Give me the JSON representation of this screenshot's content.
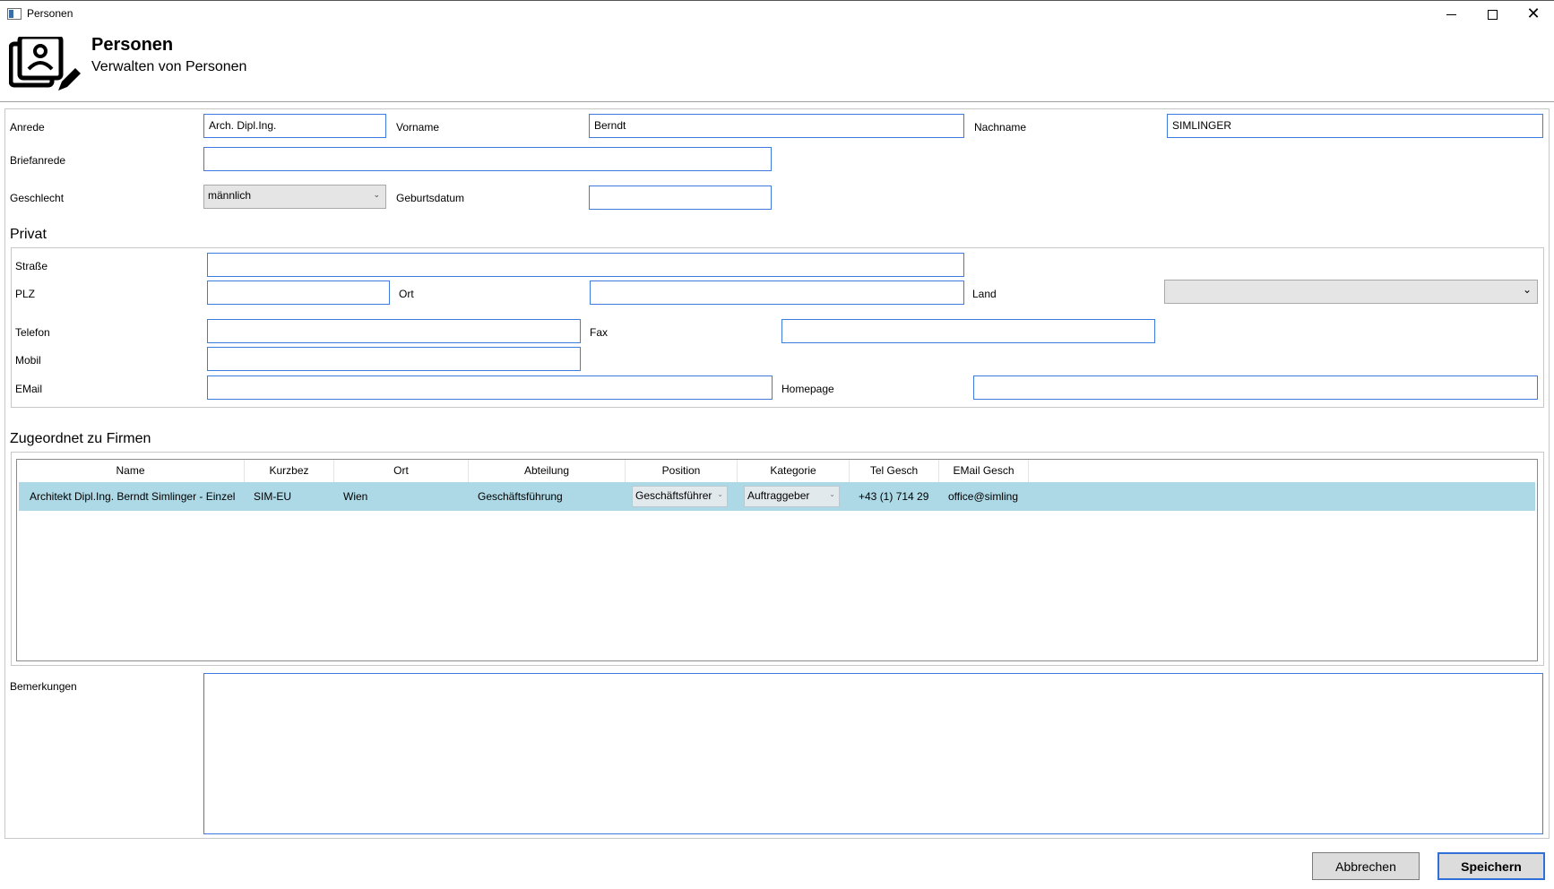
{
  "window": {
    "title": "Personen"
  },
  "header": {
    "title": "Personen",
    "subtitle": "Verwalten von Personen",
    "icon": "contacts-edit-icon"
  },
  "person": {
    "anrede_label": "Anrede",
    "anrede_value": "Arch. Dipl.Ing.",
    "vorname_label": "Vorname",
    "vorname_value": "Berndt",
    "nachname_label": "Nachname",
    "nachname_value": "SIMLINGER",
    "briefanrede_label": "Briefanrede",
    "briefanrede_value": "",
    "geschlecht_label": "Geschlecht",
    "geschlecht_value": "männlich",
    "geburtsdatum_label": "Geburtsdatum",
    "geburtsdatum_value": ""
  },
  "privat": {
    "title": "Privat",
    "strasse_label": "Straße",
    "plz_label": "PLZ",
    "ort_label": "Ort",
    "land_label": "Land",
    "telefon_label": "Telefon",
    "fax_label": "Fax",
    "mobil_label": "Mobil",
    "email_label": "EMail",
    "homepage_label": "Homepage"
  },
  "firmen": {
    "title": "Zugeordnet zu Firmen",
    "columns": [
      "Name",
      "Kurzbez",
      "Ort",
      "Abteilung",
      "Position",
      "Kategorie",
      "Tel Gesch",
      "EMail Gesch"
    ],
    "rows": [
      {
        "name": "Architekt Dipl.Ing. Berndt Simlinger - Einzel",
        "kurzbez": "SIM-EU",
        "ort": "Wien",
        "abteilung": "Geschäftsführung",
        "position": "Geschäftsführer",
        "kategorie": "Auftraggeber",
        "tel": "+43 (1) 714 29",
        "email": "office@simling"
      }
    ]
  },
  "bemerkungen": {
    "label": "Bemerkungen",
    "value": ""
  },
  "buttons": {
    "cancel": "Abbrechen",
    "save": "Speichern"
  },
  "colors": {
    "accent": "#3d7be0",
    "row_selected": "#add8e6"
  }
}
